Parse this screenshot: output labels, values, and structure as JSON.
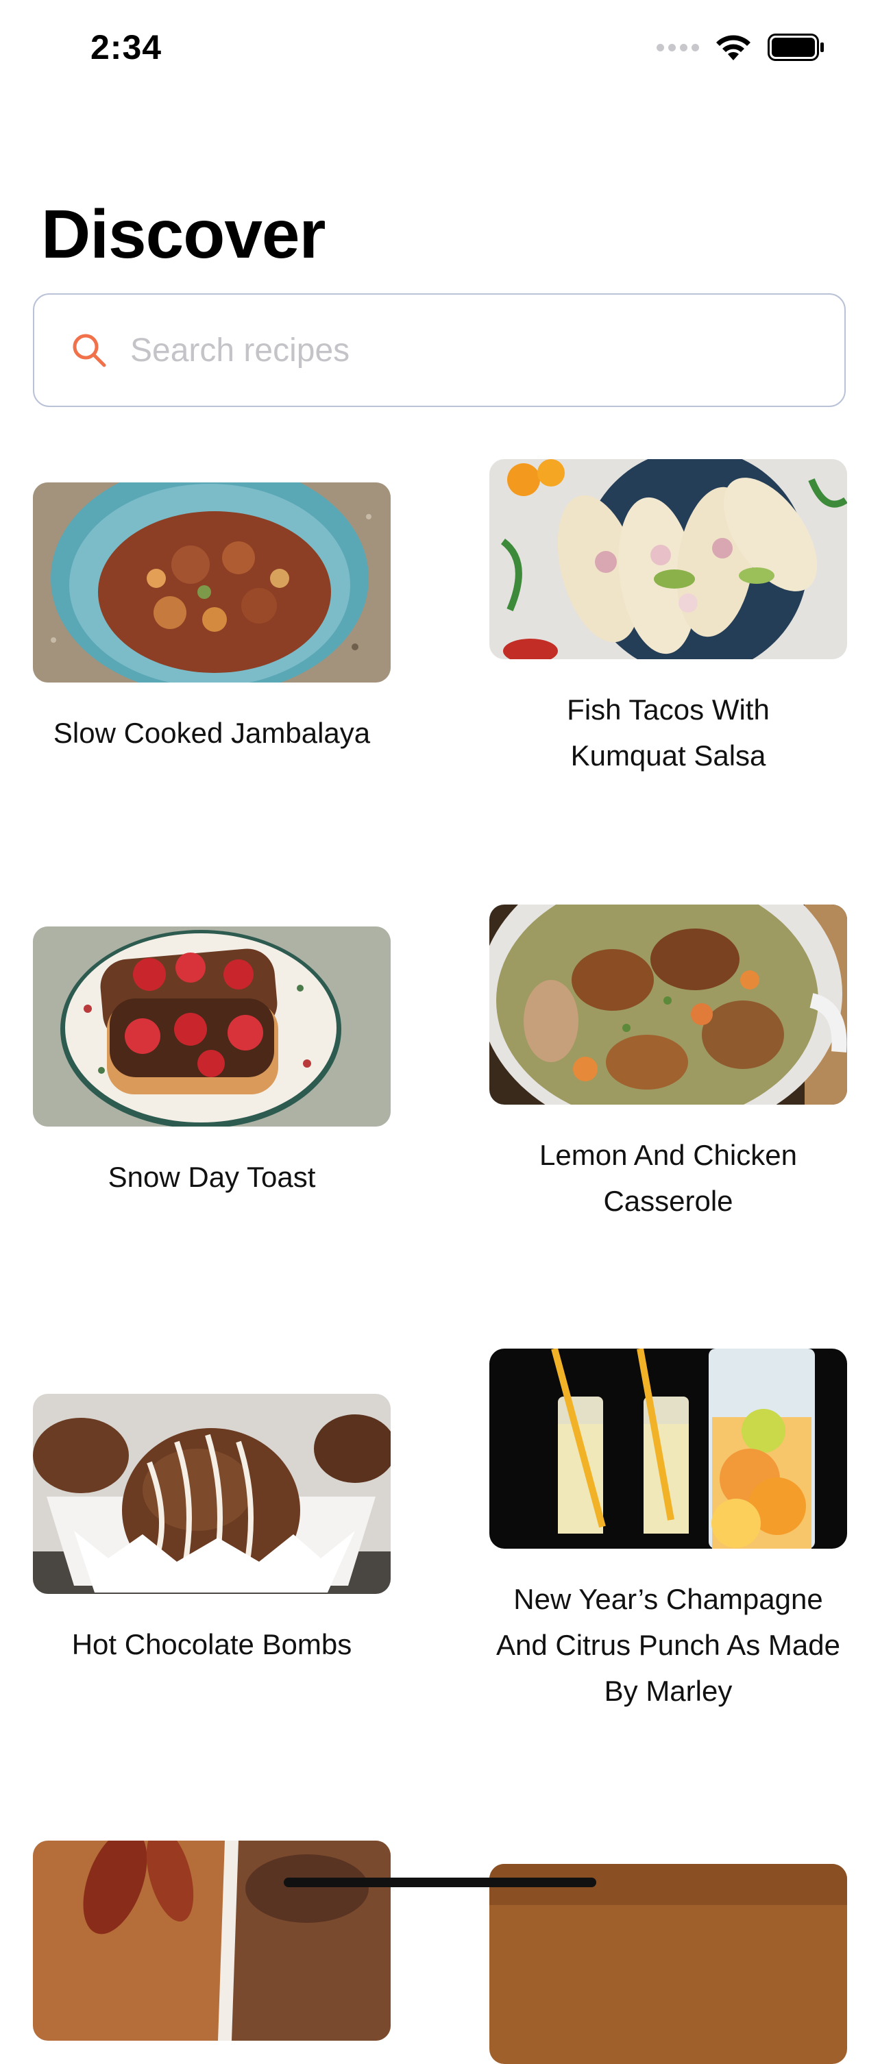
{
  "status_bar": {
    "time": "2:34"
  },
  "header": {
    "title": "Discover"
  },
  "search": {
    "placeholder": "Search recipes"
  },
  "recipes": [
    {
      "title": "Slow Cooked Jambalaya"
    },
    {
      "title": "Fish Tacos With Kumquat Salsa"
    },
    {
      "title": "Snow Day Toast"
    },
    {
      "title": "Lemon And Chicken Casserole"
    },
    {
      "title": "Hot Chocolate Bombs"
    },
    {
      "title": "New Year’s Champagne And Citrus Punch As Made By Marley"
    }
  ],
  "colors": {
    "accent": "#f0714a",
    "search_border": "#b9c2d6"
  }
}
